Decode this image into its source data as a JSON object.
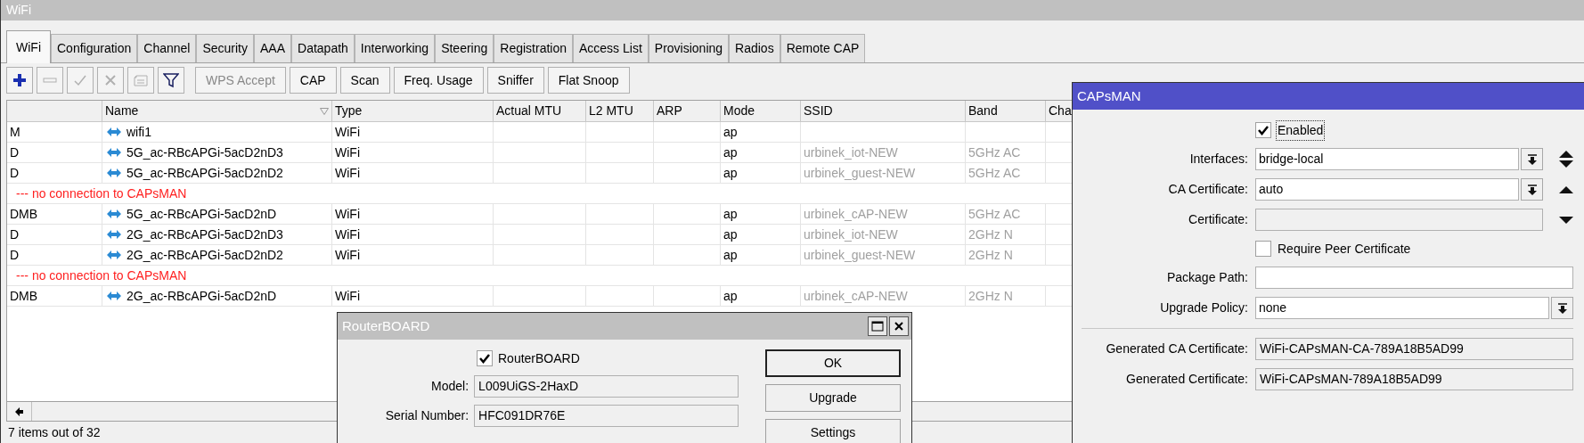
{
  "window": {
    "title": "WiFi"
  },
  "tabs": [
    {
      "label": "WiFi",
      "selected": true
    },
    {
      "label": "Configuration",
      "selected": false
    },
    {
      "label": "Channel",
      "selected": false
    },
    {
      "label": "Security",
      "selected": false
    },
    {
      "label": "AAA",
      "selected": false
    },
    {
      "label": "Datapath",
      "selected": false
    },
    {
      "label": "Interworking",
      "selected": false
    },
    {
      "label": "Steering",
      "selected": false
    },
    {
      "label": "Registration",
      "selected": false
    },
    {
      "label": "Access List",
      "selected": false
    },
    {
      "label": "Provisioning",
      "selected": false
    },
    {
      "label": "Radios",
      "selected": false
    },
    {
      "label": "Remote CAP",
      "selected": false
    }
  ],
  "toolbar": {
    "icon_buttons": [
      {
        "kind": "add",
        "disabled": false
      },
      {
        "kind": "remove",
        "disabled": true
      },
      {
        "kind": "enable",
        "disabled": true
      },
      {
        "kind": "disable",
        "disabled": true
      },
      {
        "kind": "comment",
        "disabled": true
      },
      {
        "kind": "filter",
        "disabled": false
      }
    ],
    "buttons": [
      {
        "label": "WPS Accept",
        "disabled": true
      },
      {
        "label": "CAP",
        "disabled": false
      },
      {
        "label": "Scan",
        "disabled": false
      },
      {
        "label": "Freq. Usage",
        "disabled": false
      },
      {
        "label": "Sniffer",
        "disabled": false
      },
      {
        "label": "Flat Snoop",
        "disabled": false
      }
    ]
  },
  "table": {
    "columns": [
      {
        "label": "Name",
        "sorted": true
      },
      {
        "label": "Type"
      },
      {
        "label": "Actual MTU"
      },
      {
        "label": "L2 MTU"
      },
      {
        "label": "ARP"
      },
      {
        "label": "Mode"
      },
      {
        "label": "SSID"
      },
      {
        "label": "Band"
      },
      {
        "label": "Cha"
      }
    ],
    "rows": [
      {
        "kind": "interface",
        "flags": "M",
        "name": "wifi1",
        "type": "WiFi",
        "mode": "ap"
      },
      {
        "kind": "interface",
        "flags": "D",
        "name": "5G_ac-RBcAPGi-5acD2nD3",
        "type": "WiFi",
        "mode": "ap",
        "ssid": "urbinek_iot-NEW",
        "band": "5GHz AC"
      },
      {
        "kind": "interface",
        "flags": "D",
        "name": "5G_ac-RBcAPGi-5acD2nD2",
        "type": "WiFi",
        "mode": "ap",
        "ssid": "urbinek_guest-NEW",
        "band": "5GHz AC"
      },
      {
        "kind": "comment",
        "text": "--- no connection to CAPsMAN"
      },
      {
        "kind": "interface",
        "flags": "DMB",
        "name": "5G_ac-RBcAPGi-5acD2nD",
        "type": "WiFi",
        "mode": "ap",
        "ssid": "urbinek_cAP-NEW",
        "band": "5GHz AC"
      },
      {
        "kind": "interface",
        "flags": "D",
        "name": "2G_ac-RBcAPGi-5acD2nD3",
        "type": "WiFi",
        "mode": "ap",
        "ssid": "urbinek_iot-NEW",
        "band": "2GHz N"
      },
      {
        "kind": "interface",
        "flags": "D",
        "name": "2G_ac-RBcAPGi-5acD2nD2",
        "type": "WiFi",
        "mode": "ap",
        "ssid": "urbinek_guest-NEW",
        "band": "2GHz N"
      },
      {
        "kind": "comment",
        "text": "--- no connection to CAPsMAN"
      },
      {
        "kind": "interface",
        "flags": "DMB",
        "name": "2G_ac-RBcAPGi-5acD2nD",
        "type": "WiFi",
        "mode": "ap",
        "ssid": "urbinek_cAP-NEW",
        "band": "2GHz N"
      }
    ]
  },
  "status_bar": "7 items out of 32",
  "routerboard": {
    "title": "RouterBOARD",
    "active": false,
    "checkbox": {
      "label": "RouterBOARD",
      "checked": true
    },
    "fields": [
      {
        "label": "Model:",
        "value": "L009UiGS-2HaxD"
      },
      {
        "label": "Serial Number:",
        "value": "HFC091DR76E"
      }
    ],
    "buttons": [
      {
        "label": "OK",
        "default": true
      },
      {
        "label": "Upgrade",
        "default": false
      },
      {
        "label": "Settings",
        "default": false
      }
    ]
  },
  "capsman": {
    "title": "CAPsMAN",
    "active": true,
    "rows": [
      {
        "kind": "checkbox",
        "label": "Enabled",
        "checked": true,
        "focused": true
      },
      {
        "kind": "select",
        "label": "Interfaces:",
        "value": "bridge-local",
        "up": true,
        "down": true
      },
      {
        "kind": "select",
        "label": "CA Certificate:",
        "value": "auto",
        "up": true,
        "down": false
      },
      {
        "kind": "field",
        "label": "Certificate:",
        "readonly": true,
        "up": false,
        "down": true
      },
      {
        "kind": "checkbox",
        "label": "Require Peer Certificate",
        "checked": false,
        "focused": false
      },
      {
        "kind": "field",
        "label": "Package Path:",
        "readonly": false
      },
      {
        "kind": "select",
        "label": "Upgrade Policy:",
        "value": "none"
      },
      {
        "kind": "separator"
      },
      {
        "kind": "field",
        "label": "Generated CA Certificate:",
        "value": "WiFi-CAPsMAN-CA-789A18B5AD99",
        "readonly": true
      },
      {
        "kind": "field",
        "label": "Generated Certificate:",
        "value": "WiFi-CAPsMAN-789A18B5AD99",
        "readonly": true
      }
    ]
  }
}
